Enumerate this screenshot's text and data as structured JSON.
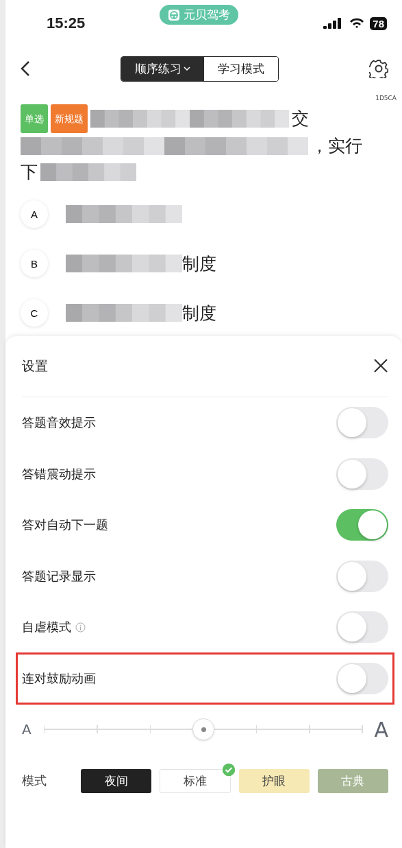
{
  "status_bar": {
    "time": "15:25",
    "app_badge": "元贝驾考",
    "battery": "78"
  },
  "nav": {
    "segments": [
      {
        "label": "顺序练习",
        "selected": true,
        "dropdown": true
      },
      {
        "label": "学习模式",
        "selected": false,
        "dropdown": false
      }
    ]
  },
  "question": {
    "code": "1D5CA",
    "tags": [
      {
        "label": "单选",
        "color": "#5cbf62"
      },
      {
        "label": "新规题",
        "color": "#ef7a30"
      }
    ],
    "lines": [
      {
        "after": "交"
      },
      {
        "after": "，实行"
      },
      {
        "before": "下"
      }
    ],
    "options": [
      {
        "letter": "A"
      },
      {
        "letter": "B",
        "text": "制度"
      },
      {
        "letter": "C",
        "text": "制度"
      }
    ]
  },
  "settings": {
    "title": "设置",
    "toggles": [
      {
        "label": "答题音效提示",
        "on": false,
        "info": false,
        "highlighted": false
      },
      {
        "label": "答错震动提示",
        "on": false,
        "info": false,
        "highlighted": false
      },
      {
        "label": "答对自动下一题",
        "on": true,
        "info": false,
        "highlighted": false
      },
      {
        "label": "答题记录显示",
        "on": false,
        "info": false,
        "highlighted": false
      },
      {
        "label": "自虐模式",
        "on": false,
        "info": true,
        "highlighted": false
      },
      {
        "label": "连对鼓励动画",
        "on": false,
        "info": false,
        "highlighted": true
      }
    ],
    "font_size": {
      "small_label": "A",
      "large_label": "A",
      "level": 0.5
    },
    "mode_label": "模式",
    "modes": [
      {
        "label": "夜间",
        "kind": "night",
        "selected": false
      },
      {
        "label": "标准",
        "kind": "standard",
        "selected": true
      },
      {
        "label": "护眼",
        "kind": "eyecare",
        "selected": false
      },
      {
        "label": "古典",
        "kind": "classic",
        "selected": false
      }
    ]
  }
}
